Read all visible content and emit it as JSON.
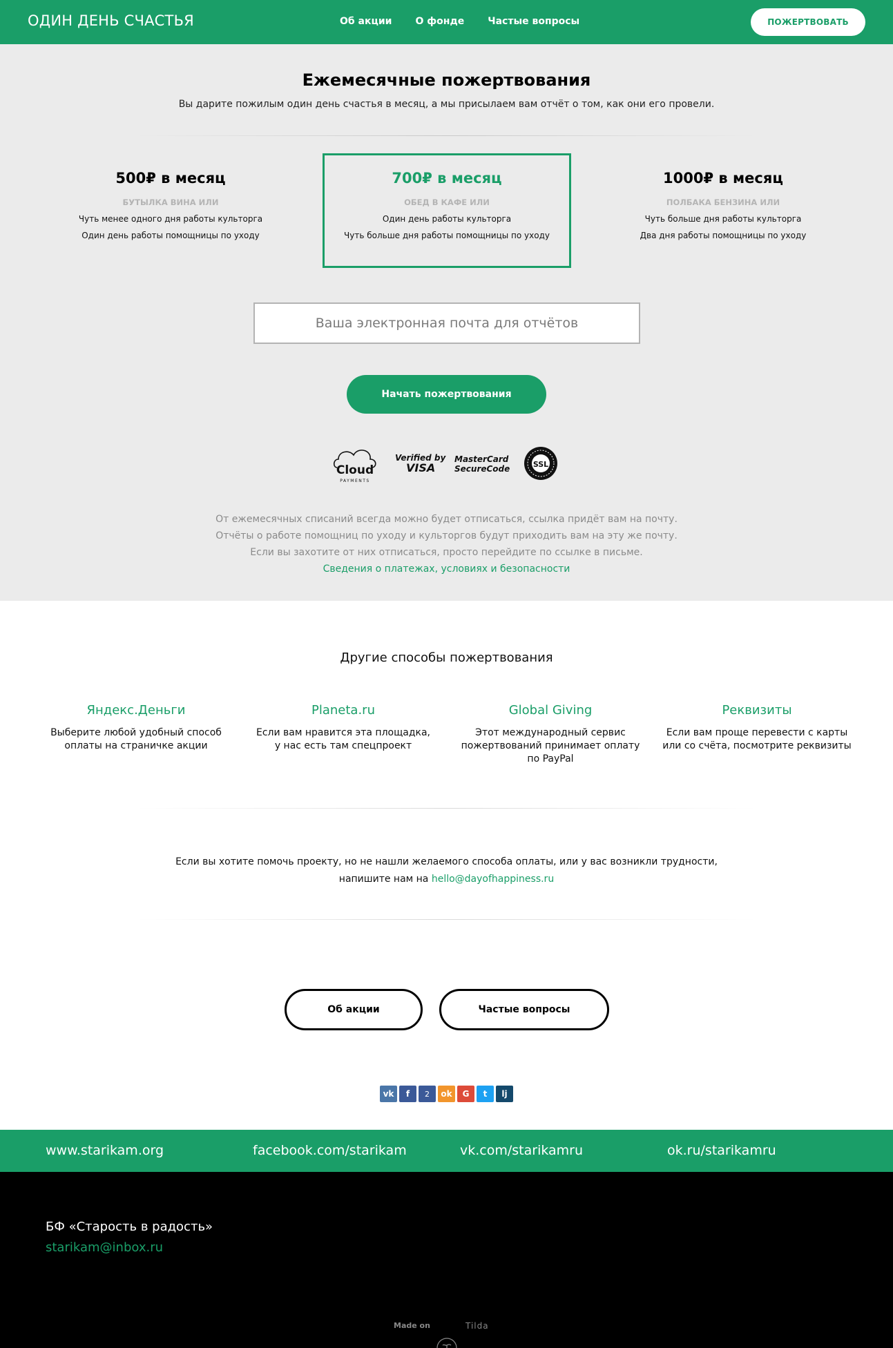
{
  "header": {
    "brand": "ОДИН ДЕНЬ СЧАСТЬЯ",
    "nav": [
      "Об акции",
      "О фонде",
      "Частые вопросы"
    ],
    "cta": "ПОЖЕРТВОВАТЬ"
  },
  "monthly": {
    "title": "Ежемесячные пожертвования",
    "subtitle": "Вы дарите пожилым один день счастья в месяц, а мы присылаем вам отчёт о том, как они его провели.",
    "plans": [
      {
        "price": "500₽ в месяц",
        "caption": "БУТЫЛКА ВИНА ИЛИ",
        "line1": "Чуть менее одного дня работы культорга",
        "line2": "Один день работы помощницы по уходу",
        "selected": false
      },
      {
        "price": "700₽ в месяц",
        "caption": "ОБЕД В КАФЕ ИЛИ",
        "line1": "Один день работы культорга",
        "line2": "Чуть больше дня работы помощницы по уходу",
        "selected": true
      },
      {
        "price": "1000₽ в месяц",
        "caption": "ПОЛБАКА БЕНЗИНА ИЛИ",
        "line1": "Чуть больше дня работы культорга",
        "line2": "Два дня работы помощницы по уходу",
        "selected": false
      }
    ],
    "email_placeholder": "Ваша электронная почта для отчётов",
    "start_button": "Начать пожертвования",
    "payment_logos": {
      "cloud": "Cloud",
      "cloud_sub": "PAYMENTS",
      "visa_top": "Verified by",
      "visa_bottom": "VISA",
      "mc_top": "MasterCard",
      "mc_bottom": "SecureCode",
      "ssl": "SSL"
    },
    "info_lines": [
      "От ежемесячных списаний всегда можно будет отписаться, ссылка придёт вам на почту.",
      "Отчёты о работе помощниц по уходу и культоргов будут приходить вам на эту же почту.",
      "Если вы захотите от них отписаться, просто перейдите по ссылке в письме."
    ],
    "info_link": "Сведения о платежах, условиях и безопасности"
  },
  "other": {
    "title": "Другие способы пожертвования",
    "ways": [
      {
        "title": "Яндекс.Деньги",
        "desc1": "Выберите любой удобный способ",
        "desc2": "оплаты на страничке акции",
        "desc3": ""
      },
      {
        "title": "Planeta.ru",
        "desc1": "Если вам нравится эта площадка,",
        "desc2": "у нас есть там спецпроект",
        "desc3": ""
      },
      {
        "title": "Global Giving",
        "desc1": "Этот международный сервис",
        "desc2": "пожертвований принимает оплату",
        "desc3": "по PayPal"
      },
      {
        "title": "Реквизиты",
        "desc1": "Если вам проще перевести с карты",
        "desc2": "или со счёта, посмотрите реквизиты",
        "desc3": ""
      }
    ],
    "help_line1": "Если вы хотите помочь проекту, но не нашли желаемого способа оплаты, или у вас возникли трудности,",
    "help_line2": "напишите нам на",
    "help_email": "hello@dayofhappiness.ru"
  },
  "buttons": {
    "about": "Об акции",
    "faq": "Частые вопросы"
  },
  "share": {
    "vk": "vk",
    "fb": "f",
    "fb_count": "2",
    "ok": "ok",
    "gplus": "G",
    "tw": "t",
    "lj": "lj"
  },
  "links": [
    "www.starikam.org",
    "facebook.com/starikam",
    "vk.com/starikamru",
    "ok.ru/starikamru"
  ],
  "footer": {
    "org": "БФ «Старость в радость»",
    "email": "starikam@inbox.ru",
    "made_on": "Made on",
    "tilda": "Tilda"
  },
  "colors": {
    "accent": "#1a9e68",
    "grey_bg": "#ebebeb",
    "footer_bg": "#000000"
  }
}
